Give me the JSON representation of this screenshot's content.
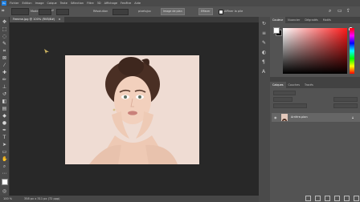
{
  "menubar": {
    "app_logo": "Ps",
    "menus": [
      "Fichier",
      "Edition",
      "Image",
      "Calque",
      "Texte",
      "Sélection",
      "Filtre",
      "3D",
      "Affichage",
      "Fenêtre",
      "Aide"
    ]
  },
  "options_bar": {
    "field_1_label": "Mode",
    "field_2_label": "Résolution",
    "field_3_label": "pixels/po",
    "button_1": "Image de plan",
    "button_2": "Effacer",
    "checkbox_label": "Affiner la pile"
  },
  "document": {
    "tab_title": "Femme.jpg @ 100% (RVB/8#)",
    "zoom": "100 %",
    "doc_size": "358 px x 311 px (72 ppp)"
  },
  "color_panel": {
    "tabs": [
      "Couleur",
      "Nuancier",
      "Dégradés",
      "Motifs"
    ],
    "foreground": "#ffffff",
    "background": "#000000"
  },
  "layers_panel": {
    "tabs": [
      "Calques",
      "Couches",
      "Tracés"
    ],
    "layer_name": "Arrière-plan"
  },
  "colors": {
    "accent": "#1f7fe0",
    "canvas_bg": "#282828",
    "panel_bg": "#535353"
  }
}
